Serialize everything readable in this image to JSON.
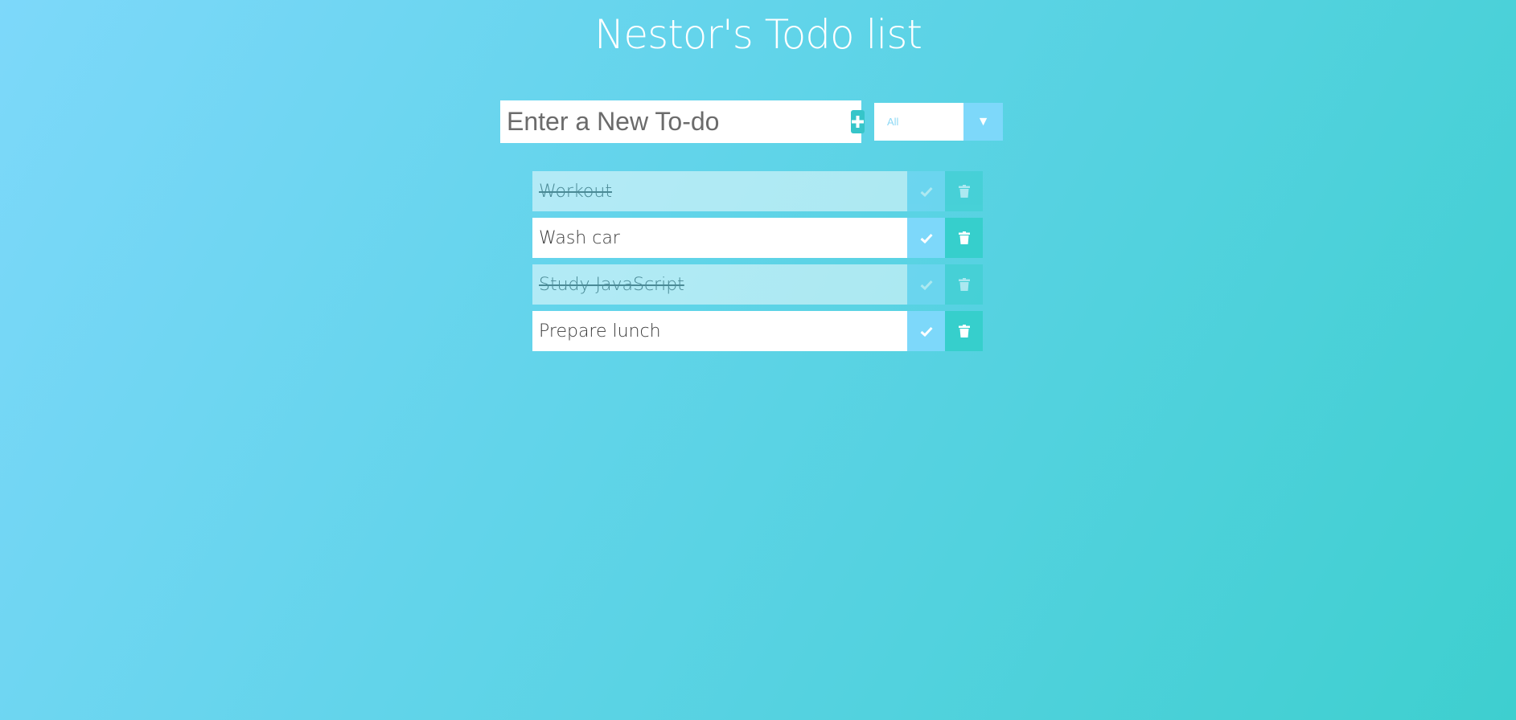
{
  "header": {
    "title": "Nestor's Todo list"
  },
  "new_todo": {
    "placeholder": "Enter a New To-do",
    "add_icon": "plus-icon"
  },
  "filter": {
    "selected": "All",
    "arrow": "▼",
    "icon": "chevron-down-icon"
  },
  "todos": [
    {
      "text": "Workout",
      "completed": true
    },
    {
      "text": "Wash car",
      "completed": false
    },
    {
      "text": "Study JavaScript",
      "completed": true
    },
    {
      "text": "Prepare lunch",
      "completed": false
    }
  ],
  "icons": {
    "check": "check-icon",
    "trash": "trash-icon"
  },
  "colors": {
    "accent_blue": "#7dd8fa",
    "accent_teal": "#36cfcc"
  }
}
